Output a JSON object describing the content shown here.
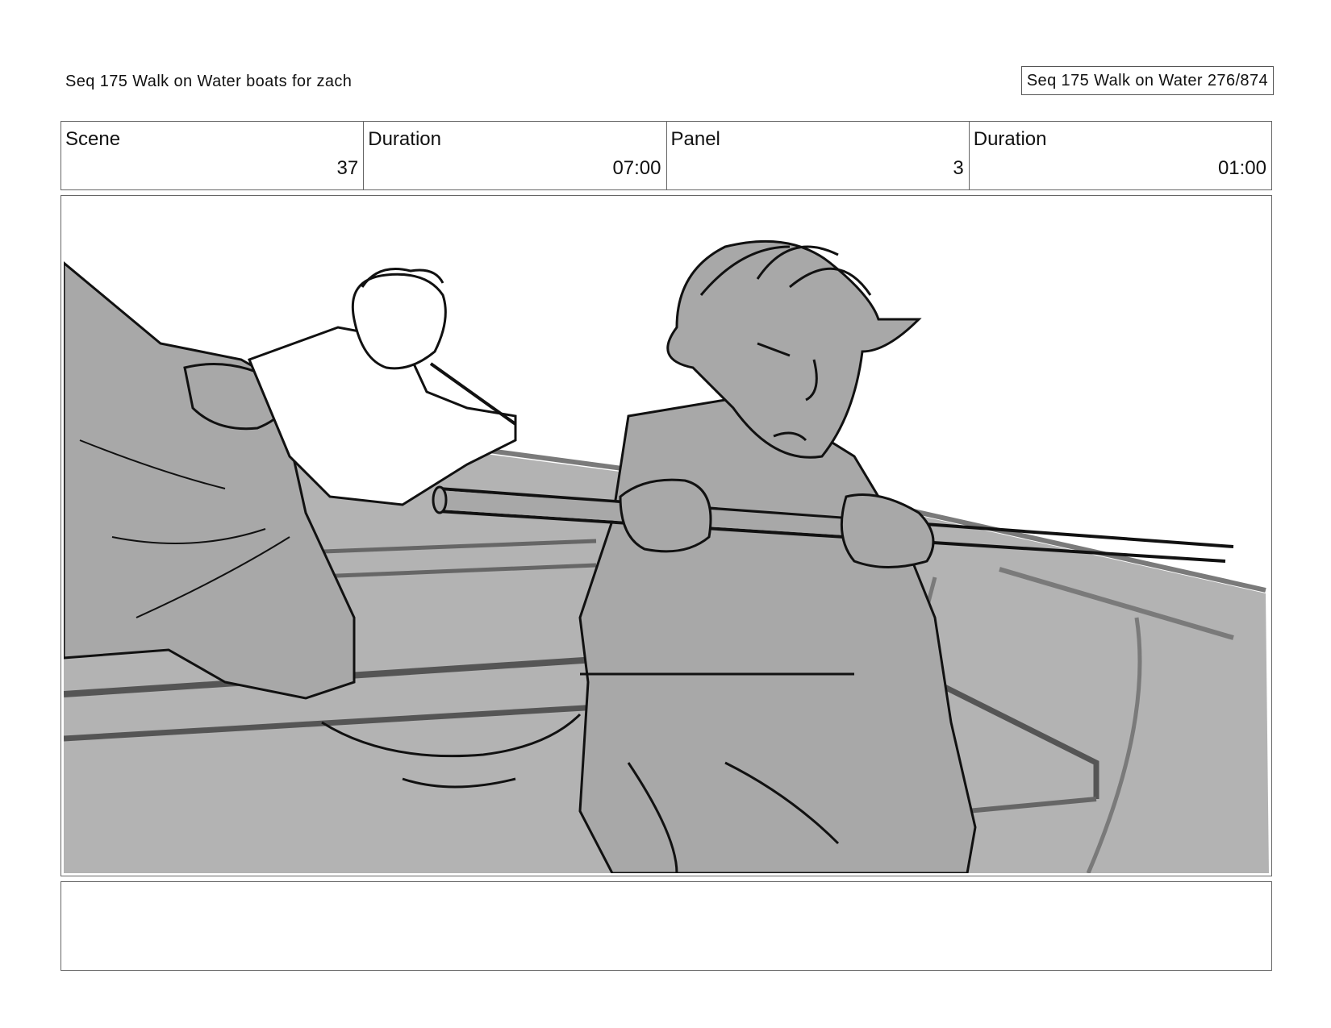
{
  "header": {
    "left_title": "Seq 175 Walk on Water  boats for zach",
    "right_title": "Seq 175 Walk on Water 276/874"
  },
  "info": {
    "scene_label": "Scene",
    "scene_value": "37",
    "scene_duration_label": "Duration",
    "scene_duration_value": "07:00",
    "panel_label": "Panel",
    "panel_value": "3",
    "panel_duration_label": "Duration",
    "panel_duration_value": "01:00"
  },
  "notes": {
    "text": ""
  },
  "colors": {
    "sketch_fill": "#b3b3b3",
    "sketch_line": "#111111",
    "sketch_mid": "#7a7a7a"
  }
}
